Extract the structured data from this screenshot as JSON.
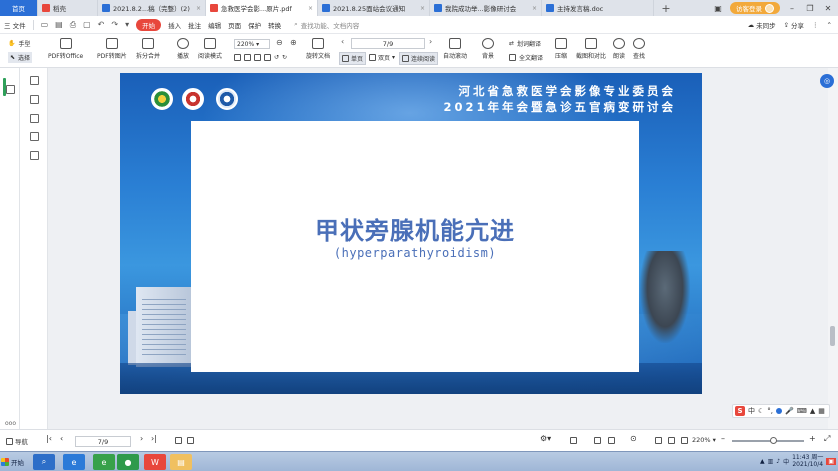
{
  "tabs": [
    {
      "label": "首页",
      "type": "home"
    },
    {
      "label": "稻壳",
      "color": "#e8473c"
    },
    {
      "label": "2021.8.2...稿（完整）(2)",
      "color": "#2b6fd6"
    },
    {
      "label": "急救医学会影...原片.pdf",
      "color": "#e8473c",
      "active": true
    },
    {
      "label": "2021.8.25面站会议通知",
      "color": "#2b6fd6"
    },
    {
      "label": "我院成功举...影像研讨会",
      "color": "#2b6fd6"
    },
    {
      "label": "主持发言稿.doc",
      "color": "#2b6fd6"
    }
  ],
  "tabbar": {
    "plus": "+",
    "login": "访客登录",
    "close_glyph": "×"
  },
  "menu": {
    "file": "三 文件",
    "start": "开始",
    "items": [
      "插入",
      "批注",
      "编辑",
      "页面",
      "保护",
      "转换"
    ],
    "search": "查找功能、文档内容",
    "unsynced": "未同步",
    "share": "分享"
  },
  "toolbar": {
    "hand": "手型",
    "select": "选择",
    "pdf_to_office": "PDF转Office",
    "pdf_to_image": "PDF转图片",
    "split_merge": "拆分合并",
    "play": "播放",
    "read_mode": "阅读模式",
    "zoom": "220%",
    "page": "7/9",
    "rotate": "旋转文档",
    "single": "单页",
    "double": "双页",
    "continuous": "连续阅读",
    "auto_scroll": "自动滚动",
    "background": "背景",
    "translate_select": "划词翻译",
    "translate_full": "全文翻译",
    "compress": "压缩",
    "screenshot": "截图和对比",
    "read_aloud": "朗读",
    "find": "查找"
  },
  "slide": {
    "header_line1": "河北省急救医学会影像专业委员会",
    "header_line2": "2021年年会暨急诊五官病变研讨会",
    "title": "甲状旁腺机能亢进",
    "subtitle": "(hyperparathyroidism)"
  },
  "ime": {
    "label": "中"
  },
  "statusbar": {
    "nav": "导航",
    "page": "7/9",
    "zoom": "220%"
  },
  "taskbar": {
    "start": "开始",
    "time": "11:43",
    "weekday": "周一",
    "date": "2021/10/4"
  }
}
